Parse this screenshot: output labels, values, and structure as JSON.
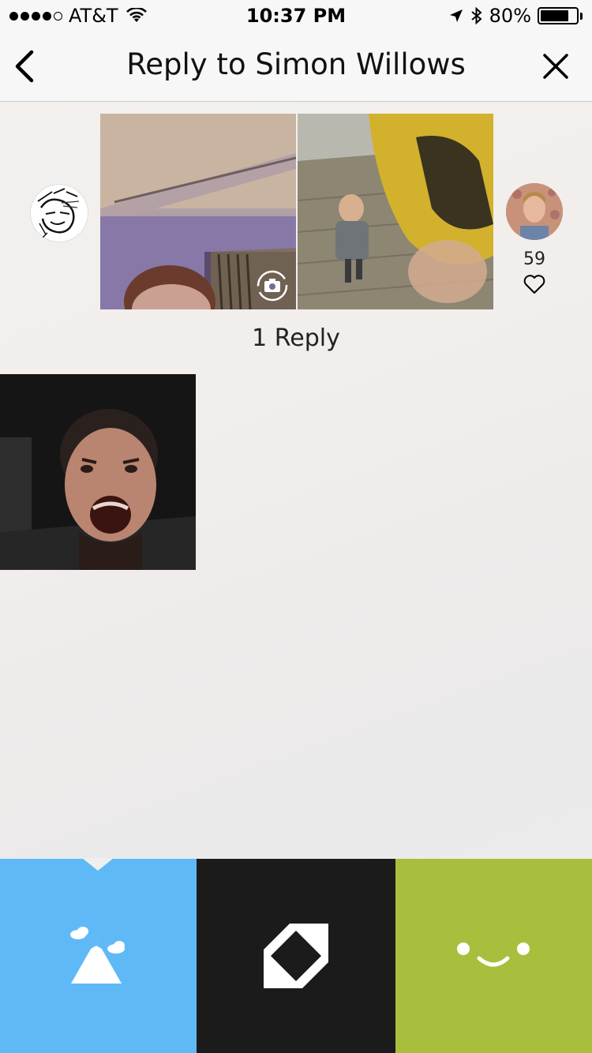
{
  "status_bar": {
    "carrier": "AT&T",
    "time": "10:37 PM",
    "battery_percent": "80%",
    "battery_level": 0.8,
    "signal_dots_filled": 4,
    "signal_dots_total": 5
  },
  "nav": {
    "title": "Reply to Simon Willows",
    "back_icon": "chevron-left-icon",
    "close_icon": "close-icon"
  },
  "post": {
    "like_count": "59",
    "left_avatar_icon": "sketch-avatar",
    "right_avatar_icon": "user-avatar",
    "camera_icon": "camera-flip-icon",
    "heart_icon": "heart-outline-icon"
  },
  "replies": {
    "count_label": "1 Reply"
  },
  "tabs": [
    {
      "name": "photo",
      "icon": "mountain-clouds-icon",
      "color": "#5fb9f7"
    },
    {
      "name": "frame",
      "icon": "diamond-frame-icon",
      "color": "#1b1b1b"
    },
    {
      "name": "face",
      "icon": "smiley-face-icon",
      "color": "#a7bf3c"
    }
  ]
}
